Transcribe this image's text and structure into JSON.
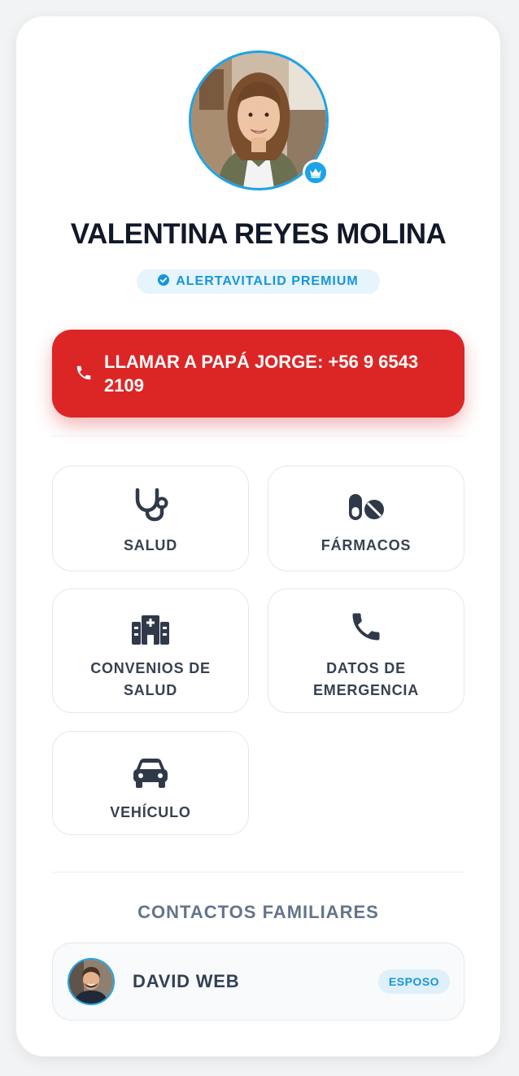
{
  "profile": {
    "name": "VALENTINA REYES MOLINA",
    "badge_label": "ALERTAVITALID PREMIUM",
    "avatar_icon": "profile-photo",
    "badge_icon": "crown-icon"
  },
  "emergency_call": {
    "label": "LLAMAR A PAPÁ JORGE: +56 9 6543 2109",
    "icon": "phone-icon",
    "color": "#dc2626"
  },
  "tiles": [
    {
      "label": "SALUD",
      "icon": "stethoscope-icon"
    },
    {
      "label": "FÁRMACOS",
      "icon": "pills-icon"
    },
    {
      "label": "CONVENIOS DE SALUD",
      "icon": "hospital-icon"
    },
    {
      "label": "DATOS DE EMERGENCIA",
      "icon": "phone-icon"
    },
    {
      "label": "VEHÍCULO",
      "icon": "car-icon"
    }
  ],
  "contacts": {
    "title": "CONTACTOS FAMILIARES",
    "items": [
      {
        "name": "DAVID WEB",
        "relation": "ESPOSO",
        "avatar_icon": "contact-photo"
      }
    ]
  },
  "colors": {
    "accent": "#1ca3e8",
    "danger": "#dc2626",
    "text": "#111827"
  }
}
